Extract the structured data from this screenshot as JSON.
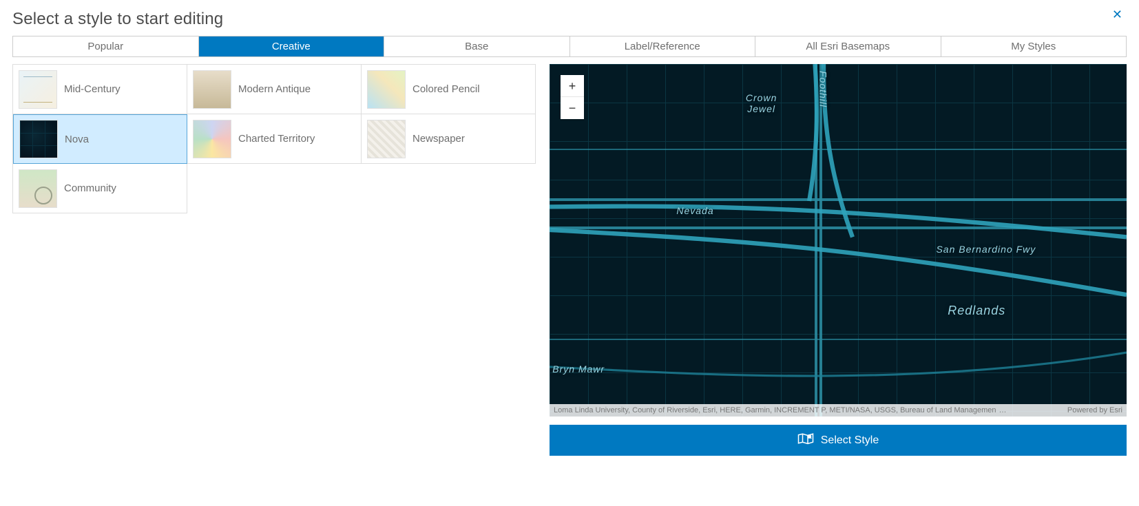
{
  "header": {
    "title": "Select a style to start editing"
  },
  "tabs": [
    {
      "label": "Popular",
      "active": false
    },
    {
      "label": "Creative",
      "active": true
    },
    {
      "label": "Base",
      "active": false
    },
    {
      "label": "Label/Reference",
      "active": false
    },
    {
      "label": "All Esri Basemaps",
      "active": false
    },
    {
      "label": "My Styles",
      "active": false
    }
  ],
  "styles": [
    {
      "label": "Mid-Century",
      "thumb": "th-midcentury",
      "selected": false
    },
    {
      "label": "Modern Antique",
      "thumb": "th-modern",
      "selected": false
    },
    {
      "label": "Colored Pencil",
      "thumb": "th-coloredpencil",
      "selected": false
    },
    {
      "label": "Nova",
      "thumb": "th-nova",
      "selected": true
    },
    {
      "label": "Charted Territory",
      "thumb": "th-charted",
      "selected": false
    },
    {
      "label": "Newspaper",
      "thumb": "th-newspaper",
      "selected": false
    },
    {
      "label": "Community",
      "thumb": "th-community",
      "selected": false
    }
  ],
  "map": {
    "labels": {
      "crown_jewel": "Crown\nJewel",
      "nevada": "Nevada",
      "san_bernardino_fwy": "San Bernardino Fwy",
      "redlands": "Redlands",
      "bryn_mawr": "Bryn Mawr",
      "foothill": "Foothill"
    },
    "attribution_left": "Loma Linda University, County of Riverside, Esri, HERE, Garmin, INCREMENT P, METI/NASA, USGS, Bureau of Land Managemen",
    "attribution_right": "Powered by Esri"
  },
  "actions": {
    "select_style": "Select Style"
  },
  "zoom": {
    "in": "+",
    "out": "−"
  }
}
